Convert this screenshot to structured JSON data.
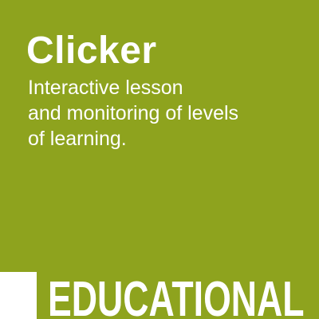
{
  "colors": {
    "accent": "#8ea31e",
    "text": "#ffffff",
    "strip": "#ffffff"
  },
  "card": {
    "title": "Clicker",
    "description_lines": [
      "Interactive lesson",
      "and monitoring of levels",
      "of learning."
    ]
  },
  "category": {
    "label": "EDUCATIONAL"
  }
}
